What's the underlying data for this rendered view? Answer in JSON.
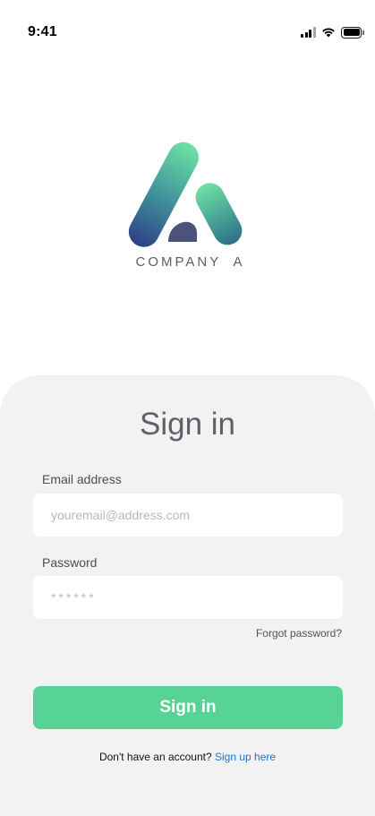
{
  "status_bar": {
    "time": "9:41",
    "icons": [
      "cellular-signal-icon",
      "wifi-icon",
      "battery-icon"
    ]
  },
  "logo": {
    "company_name": "COMPANY  A",
    "colors": {
      "gradient_top": "#6de3a6",
      "gradient_bottom": "#2e4a8a",
      "overlap": "#3a3f6e"
    }
  },
  "signin": {
    "title": "Sign in",
    "email_label": "Email address",
    "email_placeholder": "youremail@address.com",
    "email_value": "",
    "password_label": "Password",
    "password_placeholder": "******",
    "password_value": "",
    "forgot_password": "Forgot password?",
    "button_label": "Sign in",
    "no_account_text": "Don't have an account?",
    "signup_link": "Sign up here"
  },
  "colors": {
    "accent": "#57d396",
    "link": "#1a73c9",
    "card_background": "#f2f2f2"
  }
}
